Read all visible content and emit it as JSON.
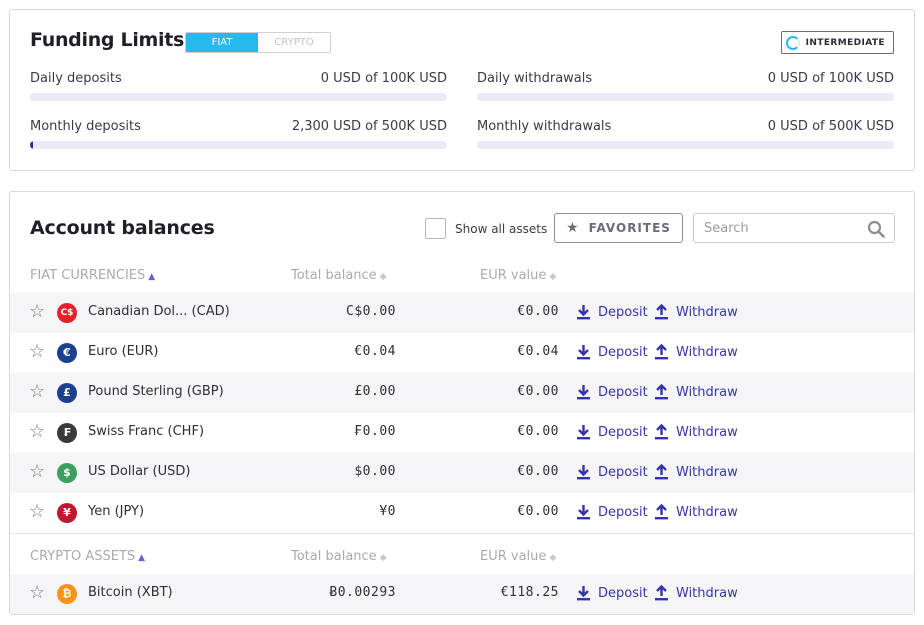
{
  "funding": {
    "title": "Funding Limits",
    "tabs": [
      "FIAT",
      "CRYPTO"
    ],
    "tier": "INTERMEDIATE",
    "limits": [
      {
        "label": "Daily deposits",
        "value": "0 USD of 100K USD",
        "progress": 0
      },
      {
        "label": "Daily withdrawals",
        "value": "0 USD of 100K USD",
        "progress": 0
      },
      {
        "label": "Monthly deposits",
        "value": "2,300 USD of 500K USD",
        "progress": 0.0046
      },
      {
        "label": "Monthly withdrawals",
        "value": "0 USD of 500K USD",
        "progress": 0
      }
    ]
  },
  "balances": {
    "title": "Account balances",
    "show_all_label": "Show all assets",
    "favorites_label": "FAVORITES",
    "search_placeholder": "Search",
    "fiat_header": {
      "name": "FIAT CURRENCIES",
      "total": "Total balance",
      "eur": "EUR value"
    },
    "crypto_header": {
      "name": "CRYPTO ASSETS",
      "total": "Total balance",
      "eur": "EUR value"
    },
    "deposit_label": "Deposit",
    "withdraw_label": "Withdraw",
    "fiat": [
      {
        "name": "Canadian Dol...  (CAD)",
        "balance": "C$0.00",
        "eur": "€0.00",
        "symbol": "C$",
        "color": "#e8202a"
      },
      {
        "name": "Euro (EUR)",
        "balance": "€0.04",
        "eur": "€0.04",
        "symbol": "€",
        "color": "#1d3f8f"
      },
      {
        "name": "Pound Sterling (GBP)",
        "balance": "£0.00",
        "eur": "€0.00",
        "symbol": "£",
        "color": "#1d3f8f"
      },
      {
        "name": "Swiss Franc (CHF)",
        "balance": "₣0.00",
        "eur": "€0.00",
        "symbol": "₣",
        "color": "#3a3a3a"
      },
      {
        "name": "US Dollar (USD)",
        "balance": "$0.00",
        "eur": "€0.00",
        "symbol": "$",
        "color": "#3aa05c"
      },
      {
        "name": "Yen (JPY)",
        "balance": "¥0",
        "eur": "€0.00",
        "symbol": "¥",
        "color": "#c0182e"
      }
    ],
    "crypto": [
      {
        "name": "Bitcoin (XBT)",
        "balance": "Ƀ0.00293",
        "eur": "€118.25",
        "symbol": "₿",
        "color": "#f7931a"
      }
    ]
  }
}
